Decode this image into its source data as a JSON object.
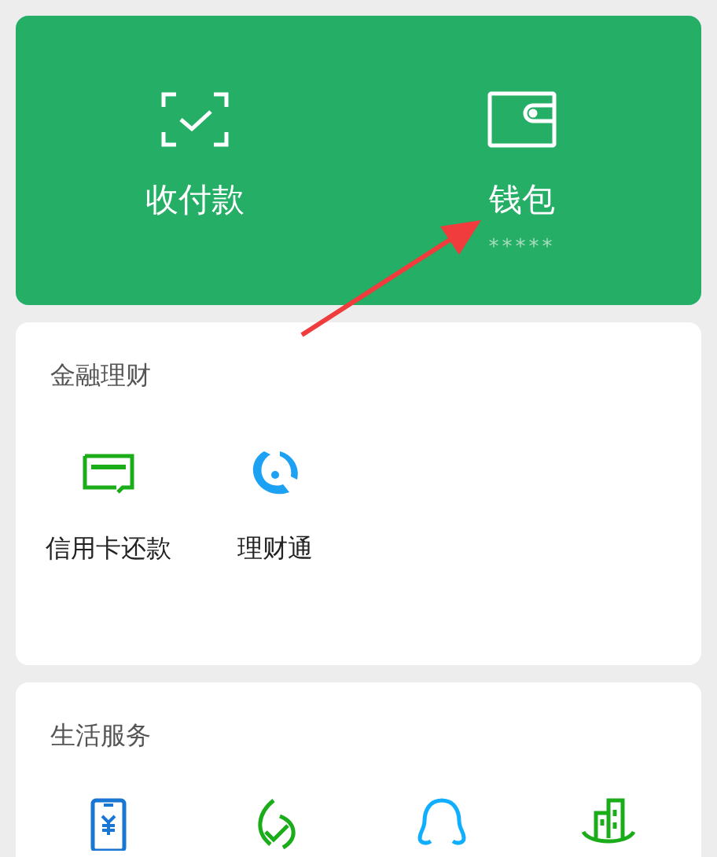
{
  "top_card": {
    "items": [
      {
        "label": "收付款"
      },
      {
        "label": "钱包",
        "sublabel": "*****"
      }
    ]
  },
  "sections": [
    {
      "title": "金融理财",
      "items": [
        {
          "label": "信用卡还款"
        },
        {
          "label": "理财通"
        }
      ]
    },
    {
      "title": "生活服务"
    }
  ]
}
